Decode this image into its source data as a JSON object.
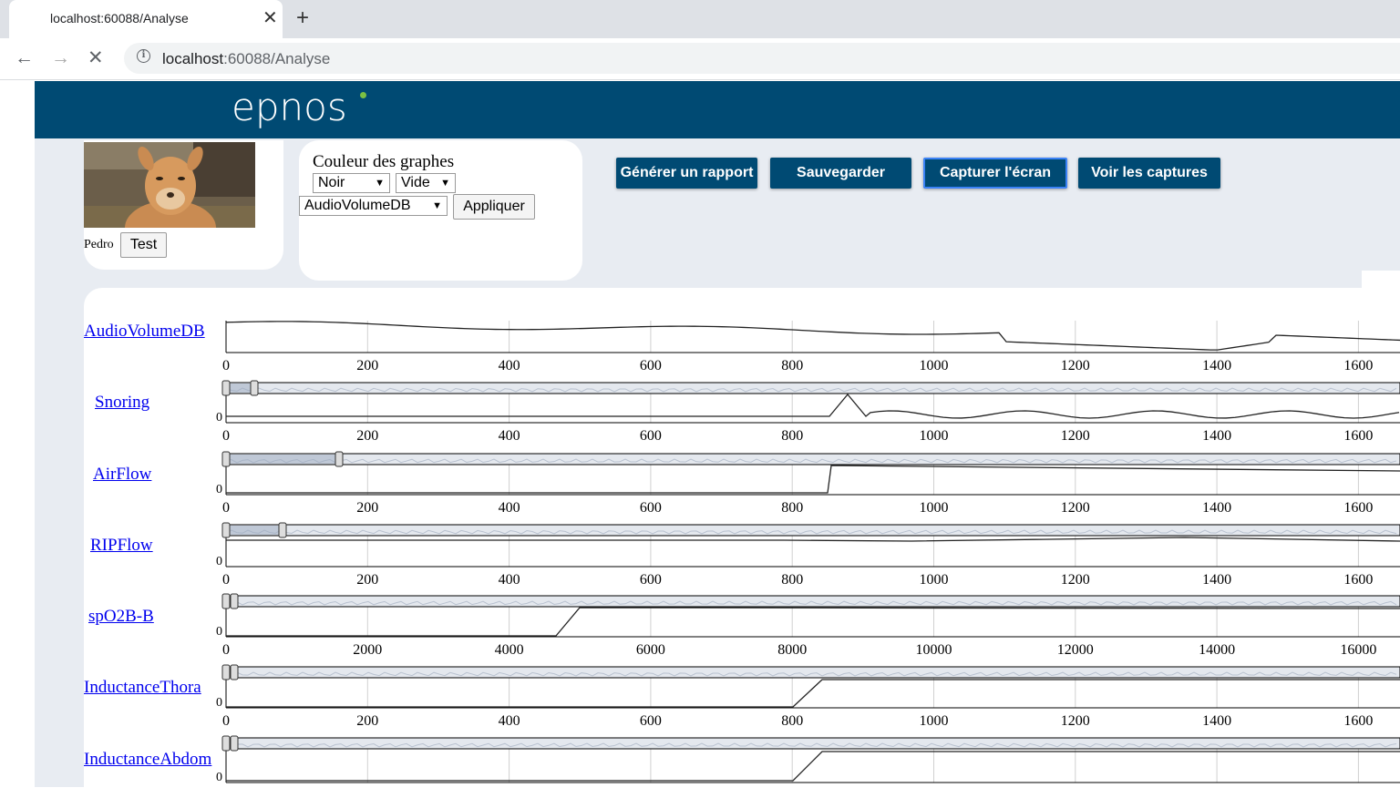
{
  "browser": {
    "tab_title": "localhost:60088/Analyse",
    "url_host": "localhost",
    "url_path": ":60088/Analyse",
    "close_glyph": "✕",
    "new_tab_glyph": "+"
  },
  "app": {
    "logo": "epnos",
    "patient": {
      "name": "Pedro",
      "test_label": "Test"
    },
    "graph_colors": {
      "title": "Couleur des graphes",
      "color_select": "Noir",
      "fill_select": "Vide",
      "channel_select": "AudioVolumeDB",
      "apply_label": "Appliquer"
    },
    "actions": [
      {
        "label": "Générer un rapport"
      },
      {
        "label": "Sauvegarder"
      },
      {
        "label": "Capturer l'écran"
      },
      {
        "label": "Voir les captures"
      }
    ],
    "accent_color": "#004a73",
    "background_color": "#e8ecf2"
  },
  "channels": [
    {
      "name": "AudioVolumeDB",
      "ticks": [
        "0",
        "200",
        "400",
        "600",
        "800",
        "1000",
        "1200",
        "1400",
        "1600"
      ]
    },
    {
      "name": "Snoring",
      "ticks": [
        "0",
        "200",
        "400",
        "600",
        "800",
        "1000",
        "1200",
        "1400",
        "1600"
      ],
      "y0": "0"
    },
    {
      "name": "AirFlow",
      "ticks": [
        "0",
        "200",
        "400",
        "600",
        "800",
        "1000",
        "1200",
        "1400",
        "1600"
      ],
      "y0": "0"
    },
    {
      "name": "RIPFlow",
      "ticks": [
        "0",
        "200",
        "400",
        "600",
        "800",
        "1000",
        "1200",
        "1400",
        "1600"
      ],
      "y0": "0"
    },
    {
      "name": "spO2B-B",
      "ticks": [
        "0",
        "2000",
        "4000",
        "6000",
        "8000",
        "10000",
        "12000",
        "14000",
        "16000"
      ],
      "y0": "0"
    },
    {
      "name": "InductanceThora",
      "ticks": [
        "0",
        "200",
        "400",
        "600",
        "800",
        "1000",
        "1200",
        "1400",
        "1600"
      ],
      "y0": "0"
    },
    {
      "name": "InductanceAbdom",
      "ticks": [],
      "y0": "0"
    }
  ]
}
